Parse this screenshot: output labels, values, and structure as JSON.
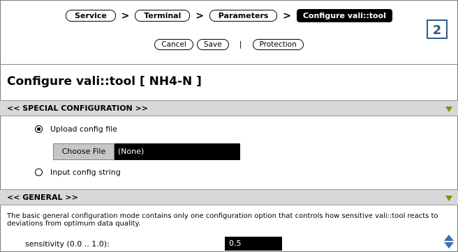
{
  "breadcrumb": {
    "items": [
      "Service",
      "Terminal",
      "Parameters"
    ],
    "current": "Configure vali::tool",
    "separator": ">"
  },
  "step_badge": "2",
  "actions": {
    "cancel": "Cancel",
    "save": "Save",
    "divider": "|",
    "protection": "Protection"
  },
  "page_title": "Configure vali::tool [ NH4-N ]",
  "special_section": {
    "label": "<<  SPECIAL CONFIGURATION  >>",
    "upload_label": "Upload config file",
    "upload_selected": true,
    "choose_file_label": "Choose File",
    "file_value": "(None)",
    "input_string_label": "Input config string"
  },
  "general_section": {
    "label": "<<  GENERAL  >>",
    "description": "The basic general configuration mode contains only one configuration option that controls how sensitive vali::tool reacts to deviations from optimum data quality.",
    "sensitivity_label": "sensitivity (0.0 .. 1.0):",
    "sensitivity_value": "0.5"
  },
  "colors": {
    "badge": "#2e5c8a",
    "section_bg": "#d8d8d8",
    "collapse_triangle": "#8a8a00",
    "spinner": "#3f6fb2"
  }
}
